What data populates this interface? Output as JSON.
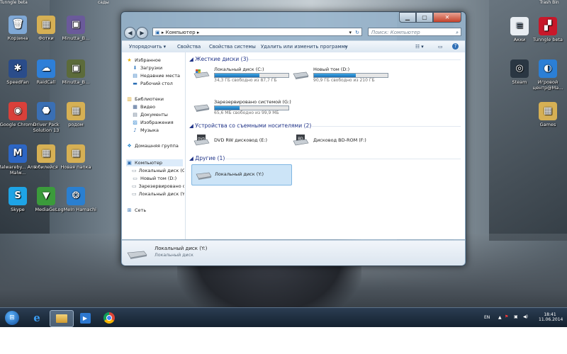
{
  "desktop": {
    "top_labels": {
      "left": "Tunngle beta",
      "center": "сады",
      "right": "Trash Bin"
    },
    "icons": [
      {
        "label": "Корзина",
        "icon": "recycle-bin-icon",
        "color": "#7fa8d6",
        "glyph": "🗑"
      },
      {
        "label": "Фотки",
        "icon": "folder-icon",
        "color": "#d6b054",
        "glyph": "▦"
      },
      {
        "label": "Minutta_B...",
        "icon": "video-file-icon",
        "color": "#6a5a9a",
        "glyph": "▣"
      },
      {
        "label": "SpeedFan",
        "icon": "speedfan-icon",
        "color": "#2a4c8a",
        "glyph": "✱"
      },
      {
        "label": "RaidCall",
        "icon": "raidcall-icon",
        "color": "#2e7fd8",
        "glyph": "☁"
      },
      {
        "label": "Minutta_B...",
        "icon": "video-file-icon",
        "color": "#5c6b3a",
        "glyph": "▣"
      },
      {
        "label": "Google Chrome",
        "icon": "chrome-icon",
        "color": "#d9403a",
        "glyph": "◉"
      },
      {
        "label": "Driver Pack Solution 13",
        "icon": "driverpack-icon",
        "color": "#3a6fb4",
        "glyph": "⬣"
      },
      {
        "label": "родом",
        "icon": "folder-icon",
        "color": "#d6b054",
        "glyph": "▦"
      },
      {
        "label": "Malwareby... Anti-Malw...",
        "icon": "malwarebytes-icon",
        "color": "#2d66c4",
        "glyph": "M"
      },
      {
        "label": "юбилейся",
        "icon": "folder-icon",
        "color": "#d6b054",
        "glyph": "▦"
      },
      {
        "label": "Новая папка",
        "icon": "folder-icon",
        "color": "#d6b054",
        "glyph": "▦"
      },
      {
        "label": "Skype",
        "icon": "skype-icon",
        "color": "#1ea4e6",
        "glyph": "S"
      },
      {
        "label": "MediaGet",
        "icon": "mediaget-icon",
        "color": "#3b9b3b",
        "glyph": "▼"
      },
      {
        "label": "LogMeIn Hamachi",
        "icon": "hamachi-icon",
        "color": "#2a7fd0",
        "glyph": "❂"
      },
      {
        "label": "Акки",
        "icon": "text-file-icon",
        "color": "#e9eef3",
        "glyph": "≡"
      },
      {
        "label": "Tunngle beta",
        "icon": "tunngle-icon",
        "color": "#c8182a",
        "glyph": "▞"
      },
      {
        "label": "Steam",
        "icon": "steam-icon",
        "color": "#2a3642",
        "glyph": "◎"
      },
      {
        "label": "Игровой центр@Ma...",
        "icon": "game-center-icon",
        "color": "#2b7fd6",
        "glyph": "◐"
      },
      {
        "label": "Games",
        "icon": "folder-icon",
        "color": "#d6b054",
        "glyph": "▦"
      }
    ]
  },
  "window": {
    "address": {
      "computer_icon": "computer-icon",
      "path": "Компьютер",
      "sep": "▸"
    },
    "search_placeholder": "Поиск: Компьютер",
    "toolbar": {
      "organize": "Упорядочить ▾",
      "properties": "Свойства",
      "system_properties": "Свойства системы",
      "uninstall": "Удалить или изменить программу",
      "more": "»",
      "view": "☷ ▾",
      "preview": "▭",
      "help": "?"
    },
    "nav": {
      "favorites": "Избранное",
      "downloads": "Загрузки",
      "recent": "Недавние места",
      "desktop": "Рабочий стол",
      "libraries": "Библиотеки",
      "video": "Видео",
      "documents": "Документы",
      "images": "Изображения",
      "music": "Музыка",
      "homegroup": "Домашняя группа",
      "computer": "Компьютер",
      "drives": [
        "Локальный диск (C",
        "Новый том (D:)",
        "Зарезервировано с",
        "Локальный диск (Y:"
      ],
      "network": "Сеть"
    },
    "groups": {
      "hdd": "Жесткие диски (3)",
      "removable": "Устройства со съемными носителями (2)",
      "other": "Другие (1)"
    },
    "hdd": [
      {
        "name": "Локальный диск (C:)",
        "free": "34,3 ГБ свободно из 87,7 ГБ",
        "used_fraction": 0.61
      },
      {
        "name": "Новый том (D:)",
        "free": "90,9 ГБ свободно из 210 ГБ",
        "used_fraction": 0.57
      },
      {
        "name": "Зарезервировано системой (G:)",
        "free": "65,6 МБ свободно из 99,9 МБ",
        "used_fraction": 0.34
      }
    ],
    "removable": [
      {
        "name": "DVD RW дисковод (E:)",
        "badge": "DVD"
      },
      {
        "name": "Дисковод BD-ROM (F:)",
        "badge": "BD"
      }
    ],
    "other": [
      {
        "name": "Локальный диск (Y:)"
      }
    ],
    "details": {
      "title": "Локальный диск (Y:)",
      "subtitle": "Локальный диск"
    }
  },
  "taskbar": {
    "lang": "EN",
    "time": "18:41",
    "date": "11.06.2014"
  }
}
